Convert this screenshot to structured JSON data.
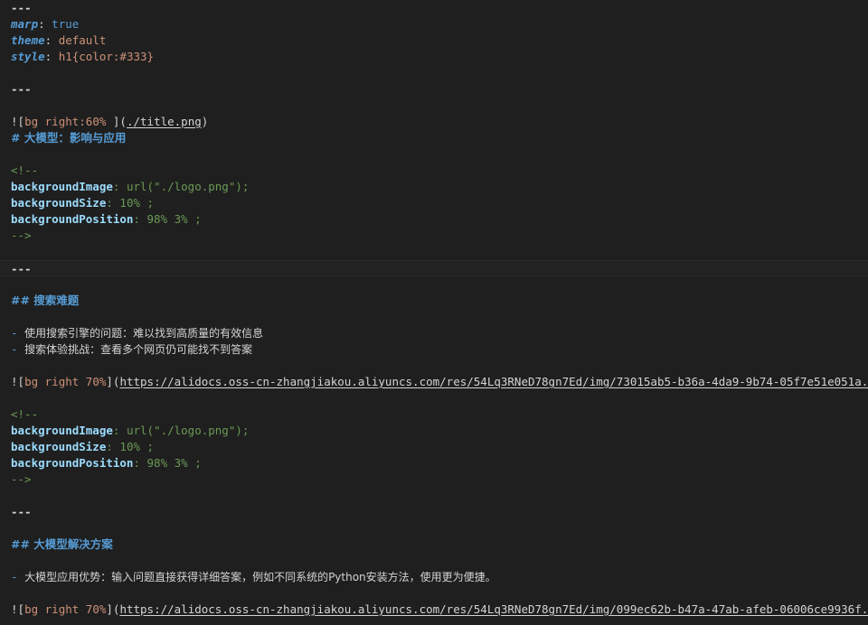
{
  "editor": {
    "lines": [
      {
        "kind": "sep",
        "text": "---"
      },
      {
        "kind": "kv",
        "key": "marp",
        "value": "true",
        "vtype": "bool"
      },
      {
        "kind": "kv",
        "key": "theme",
        "value": "default",
        "vtype": "str"
      },
      {
        "kind": "kv",
        "key": "style",
        "value": "h1{color:#333}",
        "vtype": "str"
      },
      {
        "kind": "blank"
      },
      {
        "kind": "sep",
        "text": "---"
      },
      {
        "kind": "blank"
      },
      {
        "kind": "image",
        "alt": "bg right:60% ",
        "url": "./title.png"
      },
      {
        "kind": "heading",
        "text": "# 大模型：影响与应用"
      },
      {
        "kind": "blank"
      },
      {
        "kind": "comment",
        "text": "<!--"
      },
      {
        "kind": "cmt-kv",
        "key": "backgroundImage",
        "value": "url(\"./logo.png\");"
      },
      {
        "kind": "cmt-kv",
        "key": "backgroundSize",
        "value": "10% ;"
      },
      {
        "kind": "cmt-kv",
        "key": "backgroundPosition",
        "value": "98% 3% ;"
      },
      {
        "kind": "comment",
        "text": "-->"
      },
      {
        "kind": "blank"
      },
      {
        "kind": "sep",
        "text": "---",
        "active": true
      },
      {
        "kind": "blank"
      },
      {
        "kind": "heading",
        "text": "## 搜索难题"
      },
      {
        "kind": "blank"
      },
      {
        "kind": "list",
        "text": "使用搜索引擎的问题：难以找到高质量的有效信息"
      },
      {
        "kind": "list",
        "text": "搜索体验挑战：查看多个网页仍可能找不到答案"
      },
      {
        "kind": "blank"
      },
      {
        "kind": "image",
        "alt": "bg right 70%",
        "url": "https://alidocs.oss-cn-zhangjiakou.aliyuncs.com/res/54Lq3RNeD78gn7Ed/img/73015ab5-b36a-4da9-9b74-05f7e51e051a.png"
      },
      {
        "kind": "blank"
      },
      {
        "kind": "comment",
        "text": "<!--"
      },
      {
        "kind": "cmt-kv",
        "key": "backgroundImage",
        "value": "url(\"./logo.png\");"
      },
      {
        "kind": "cmt-kv",
        "key": "backgroundSize",
        "value": "10% ;"
      },
      {
        "kind": "cmt-kv",
        "key": "backgroundPosition",
        "value": "98% 3% ;"
      },
      {
        "kind": "comment",
        "text": "-->"
      },
      {
        "kind": "blank"
      },
      {
        "kind": "sep",
        "text": "---"
      },
      {
        "kind": "blank"
      },
      {
        "kind": "heading",
        "text": "## 大模型解决方案"
      },
      {
        "kind": "blank"
      },
      {
        "kind": "list",
        "text": "大模型应用优势：输入问题直接获得详细答案，例如不同系统的Python安装方法，使用更为便捷。"
      },
      {
        "kind": "blank"
      },
      {
        "kind": "image",
        "alt": "bg right 70%",
        "url": "https://alidocs.oss-cn-zhangjiakou.aliyuncs.com/res/54Lq3RNeD78gn7Ed/img/099ec62b-b47a-47ab-afeb-06006ce9936f.png"
      }
    ]
  }
}
